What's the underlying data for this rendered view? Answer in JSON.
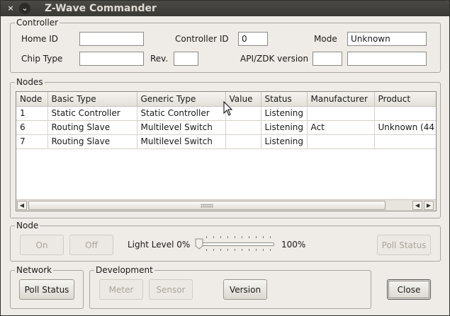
{
  "window": {
    "title": "Z-Wave Commander",
    "close_glyph": "×",
    "menu_glyph": "⌄"
  },
  "controller": {
    "legend": "Controller",
    "home_id_label": "Home ID",
    "home_id_value": "",
    "controller_id_label": "Controller ID",
    "controller_id_value": "0",
    "mode_label": "Mode",
    "mode_value": "Unknown",
    "chip_type_label": "Chip Type",
    "chip_type_value": "",
    "rev_label": "Rev.",
    "rev_value": "",
    "api_label": "API/ZDK version",
    "api_value_1": "",
    "api_value_2": ""
  },
  "nodes": {
    "legend": "Nodes",
    "columns": [
      "Node",
      "Basic Type",
      "Generic Type",
      "Value",
      "Status",
      "Manufacturer",
      "Product"
    ],
    "rows": [
      [
        "1",
        "Static Controller",
        "Static Controller",
        "",
        "Listening",
        "",
        ""
      ],
      [
        "6",
        "Routing Slave",
        "Multilevel Switch",
        "",
        "Listening",
        "Act",
        "Unknown (44"
      ],
      [
        "7",
        "Routing Slave",
        "Multilevel Switch",
        "",
        "Listening",
        "",
        ""
      ]
    ],
    "scroll_left_glyph": "◀",
    "scroll_right_glyph": "▶"
  },
  "node": {
    "legend": "Node",
    "on_label": "On",
    "off_label": "Off",
    "light_level_label": "Light Level 0%",
    "light_level_max": "100%",
    "light_level_value": 0,
    "poll_status_label": "Poll Status"
  },
  "network": {
    "legend": "Network",
    "poll_status_label": "Poll Status"
  },
  "development": {
    "legend": "Development",
    "meter_label": "Meter",
    "sensor_label": "Sensor",
    "version_label": "Version"
  },
  "close_label": "Close",
  "icons": {
    "window_close": "close-icon",
    "window_menu": "chevron-down-icon",
    "mouse_cursor": "pointer-cursor-icon",
    "scroll_left": "arrow-left-icon",
    "scroll_right": "arrow-right-icon"
  }
}
